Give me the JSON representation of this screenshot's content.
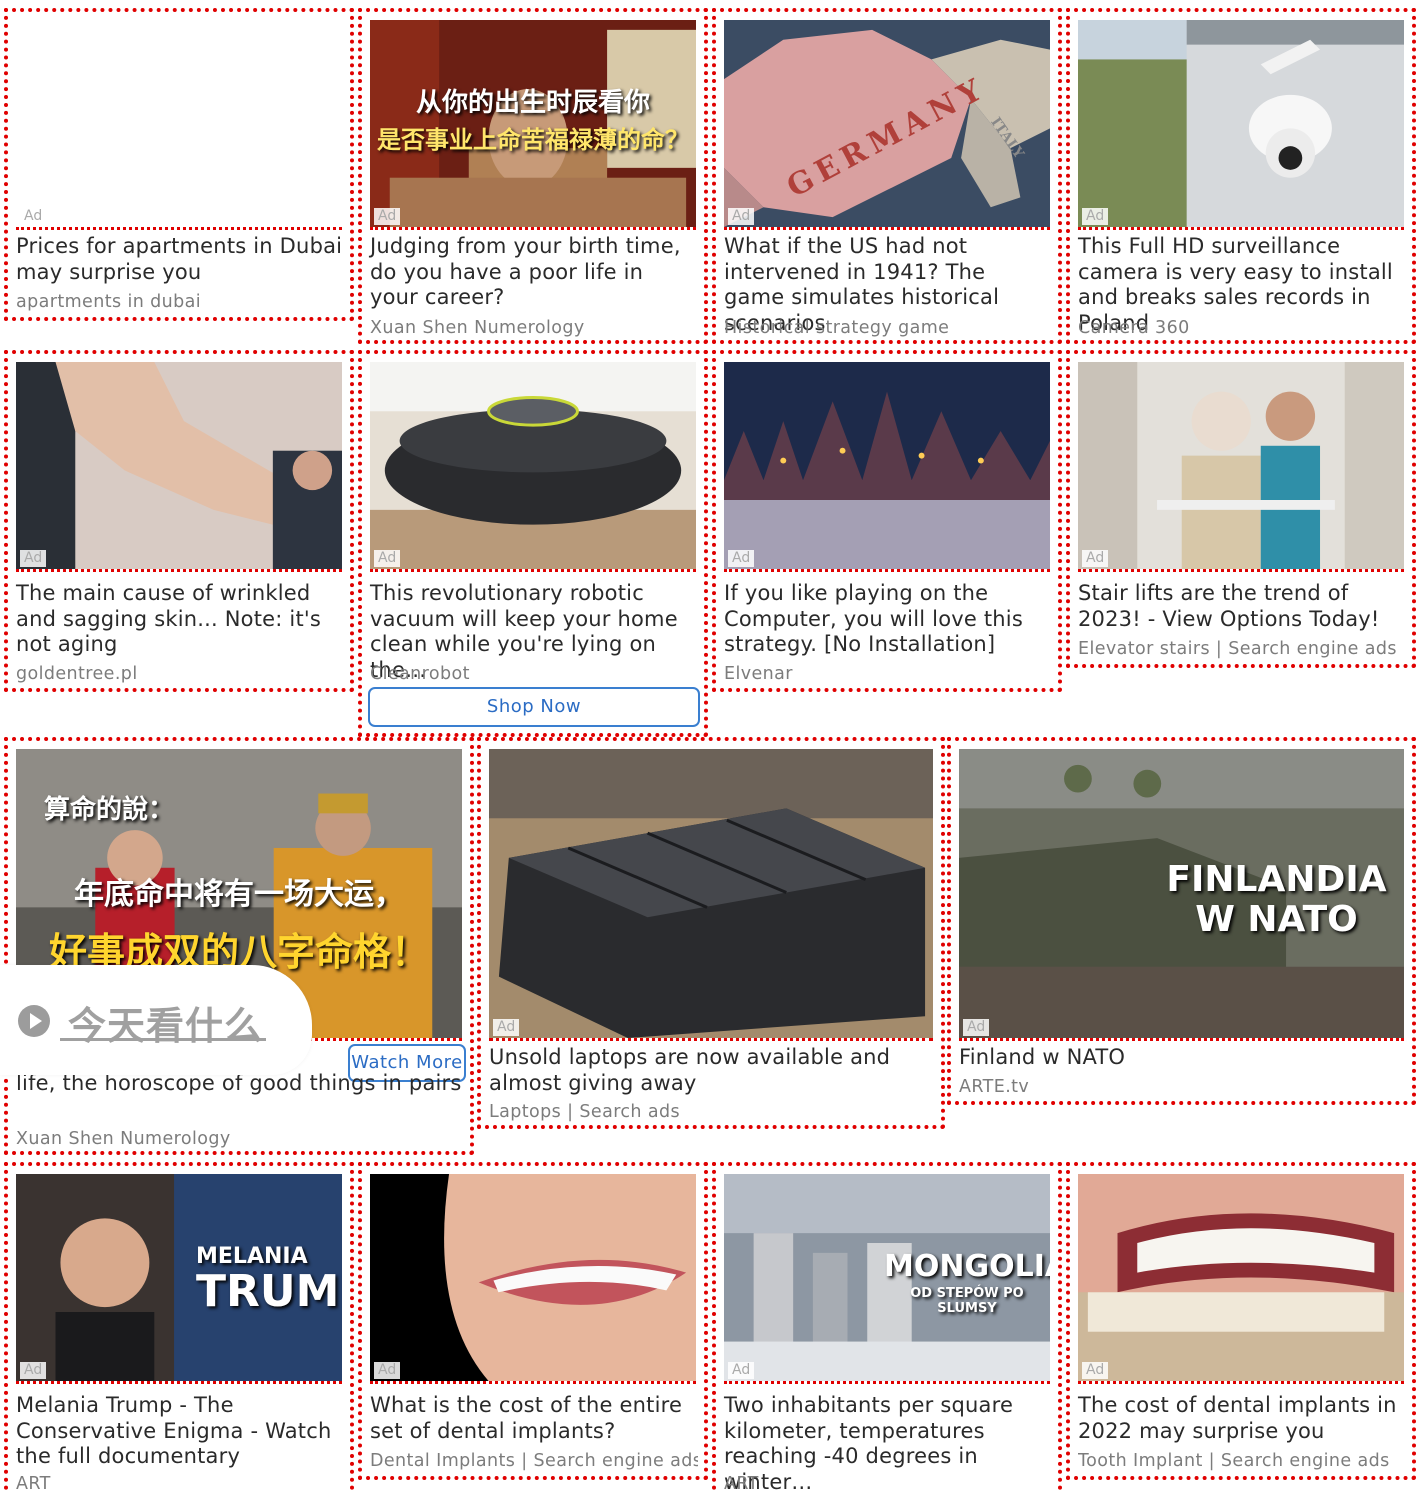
{
  "ad_label": "Ad",
  "cards": [
    {
      "title": "Prices for apartments in Dubai may surprise you",
      "source": "apartments in dubai"
    },
    {
      "title": "Judging from your birth time, do you have a poor life in your career?",
      "source": "Xuan Shen Numerology",
      "overlay": [
        "从你的出生时辰看你",
        "是否事业上命苦福禄薄的命？"
      ]
    },
    {
      "title": "What if the US had not intervened in 1941? The game simulates historical scenarios",
      "source": "Historical strategy game",
      "overlay": [
        "GERMANY",
        "ITALY"
      ]
    },
    {
      "title": "This Full HD surveillance camera is very easy to install and breaks sales records in Poland",
      "source": "Camera 360"
    },
    {
      "title": "The main cause of wrinkled and sagging skin... Note: it's not aging",
      "source": "goldentree.pl"
    },
    {
      "title": "This revolutionary robotic vacuum will keep your home clean while you're lying on the…",
      "source": "Cleanrobot",
      "button": "Shop Now"
    },
    {
      "title": "If you like playing on the Computer, you will love this strategy. [No Installation]",
      "source": "Elvenar"
    },
    {
      "title": "Stair lifts are the trend of 2023! - View Options Today!",
      "source": "Elevator stairs | Search engine ads"
    },
    {
      "title": "life, the horoscope of good things in pairs",
      "source": "Xuan Shen Numerology",
      "button": "Watch More",
      "overlay": [
        "算命的說：",
        "年底命中将有一场大运，",
        "好事成双的八字命格！"
      ]
    },
    {
      "title": "Unsold laptops are now available and almost giving away",
      "source": "Laptops | Search ads"
    },
    {
      "title": "Finland w NATO",
      "source": "ARTE.tv",
      "overlay": [
        "FINLANDIA",
        "W NATO"
      ]
    },
    {
      "title": "Melania Trump - The Conservative Enigma - Watch the full documentary",
      "source": "ART",
      "overlay": [
        "MELANIA",
        "TRUMP"
      ]
    },
    {
      "title": "What is the cost of the entire set of dental implants?",
      "source": "Dental Implants | Search engine ads"
    },
    {
      "title": "Two inhabitants per square kilometer, temperatures reaching -40 degrees in winter…",
      "source": "ART",
      "overlay": [
        "MONGOLIA",
        "OD STEPÓW PO SLUMSY"
      ]
    },
    {
      "title": "The cost of dental implants in 2022 may surprise you",
      "source": "Tooth Implant | Search engine ads"
    }
  ],
  "popup": {
    "label": "今天看什么",
    "icon": "play-circle-icon"
  },
  "colors": {
    "border": "#e00000",
    "button": "#2b6cc4",
    "source": "#7c7c7c"
  }
}
